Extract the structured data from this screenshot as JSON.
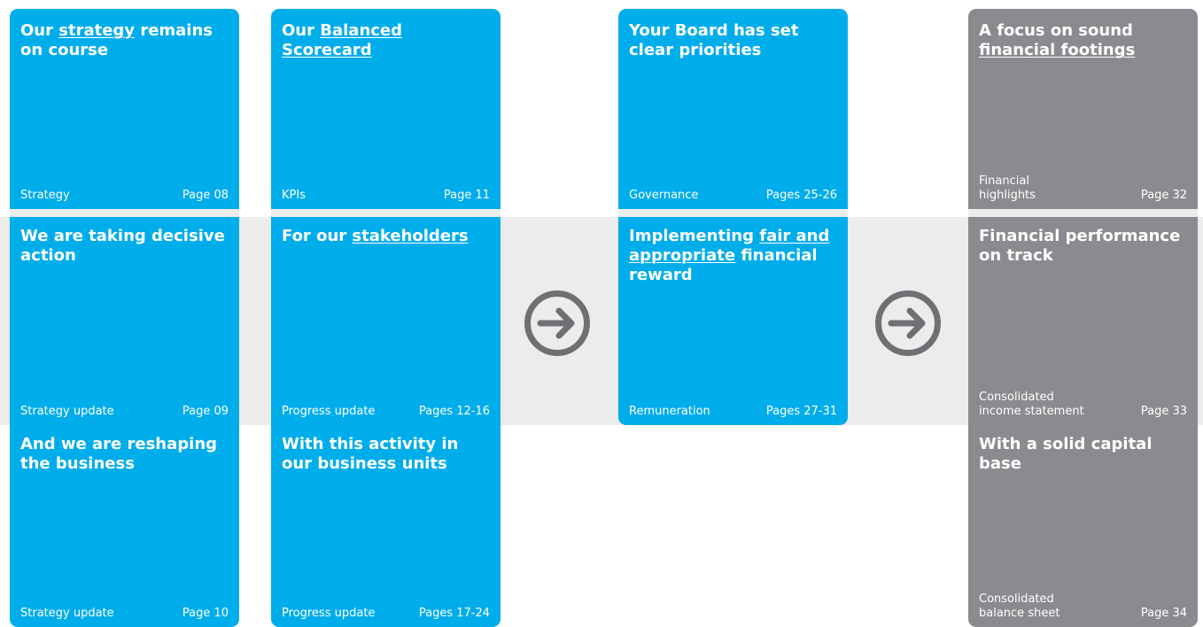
{
  "colors": {
    "blue": "#00adeb",
    "grey": "#898b8e",
    "band": "#ececed",
    "arrow": "#6e7073"
  },
  "columns": [
    {
      "name": "strategy",
      "cards": [
        {
          "title_parts": [
            "Our ",
            "strategy",
            " remains on course"
          ],
          "footer_label": [
            "Strategy"
          ],
          "footer_page": "Page 08"
        },
        {
          "title_parts": [
            "We are taking decisive action"
          ],
          "footer_label": [
            "Strategy update"
          ],
          "footer_page": "Page 09"
        },
        {
          "title_parts": [
            "And we are reshaping the business"
          ],
          "footer_label": [
            "Strategy update"
          ],
          "footer_page": "Page 10"
        }
      ]
    },
    {
      "name": "scorecard",
      "cards": [
        {
          "title_parts": [
            "Our ",
            "Balanced Scorecard"
          ],
          "footer_label": [
            "KPIs"
          ],
          "footer_page": "Page 11"
        },
        {
          "title_parts": [
            "For our ",
            "stakeholders"
          ],
          "footer_label": [
            "Progress update"
          ],
          "footer_page": "Pages 12-16"
        },
        {
          "title_parts": [
            "With this activity in our business units"
          ],
          "footer_label": [
            "Progress update"
          ],
          "footer_page": "Pages 17-24"
        }
      ]
    },
    {
      "name": "board",
      "cards": [
        {
          "title_parts": [
            "Your Board has set clear priorities"
          ],
          "footer_label": [
            "Governance"
          ],
          "footer_page": "Pages 25-26"
        },
        {
          "title_parts": [
            "Implementing ",
            "fair and appropriate",
            " financial reward"
          ],
          "footer_label": [
            "Remuneration"
          ],
          "footer_page": "Pages 27-31"
        }
      ]
    },
    {
      "name": "finance",
      "cards": [
        {
          "title_parts": [
            "A focus on sound ",
            "financial footings"
          ],
          "footer_label": [
            "Financial",
            "highlights"
          ],
          "footer_page": "Page 32"
        },
        {
          "title_parts": [
            "Financial performance on track"
          ],
          "footer_label": [
            "Consolidated",
            "income statement"
          ],
          "footer_page": "Page 33"
        },
        {
          "title_parts": [
            "With a solid capital base"
          ],
          "footer_label": [
            "Consolidated",
            "balance sheet"
          ],
          "footer_page": "Page 34"
        }
      ]
    }
  ],
  "icons": {
    "arrow_1": "arrow-right-circle-icon",
    "arrow_2": "arrow-right-circle-icon"
  }
}
